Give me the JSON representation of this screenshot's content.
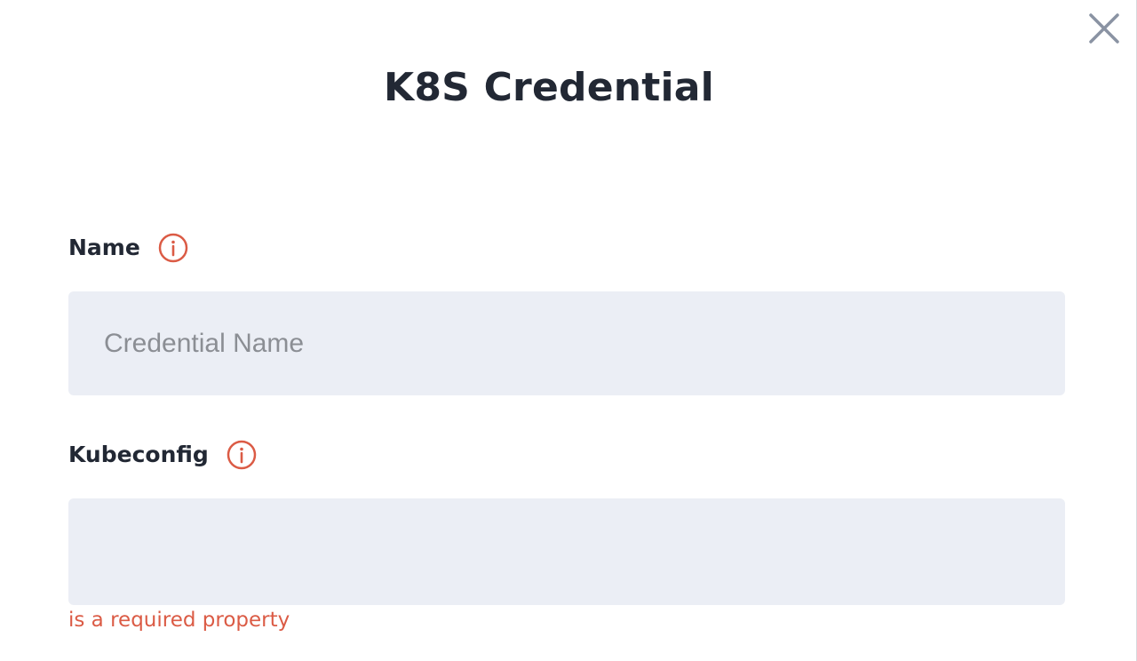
{
  "dialog": {
    "title": "K8S Credential",
    "close_icon": "close-icon",
    "colors": {
      "accent_error": "#db5b45",
      "input_background": "#ebeef5",
      "text_primary": "#222834",
      "placeholder": "#8b8e94",
      "close_icon": "#8a93a3"
    }
  },
  "form": {
    "name": {
      "label": "Name",
      "info_icon": "info-icon",
      "value": "",
      "placeholder": "Credential Name"
    },
    "kubeconfig": {
      "label": "Kubeconfig",
      "info_icon": "info-icon",
      "value": "",
      "error": "is a required property"
    }
  }
}
